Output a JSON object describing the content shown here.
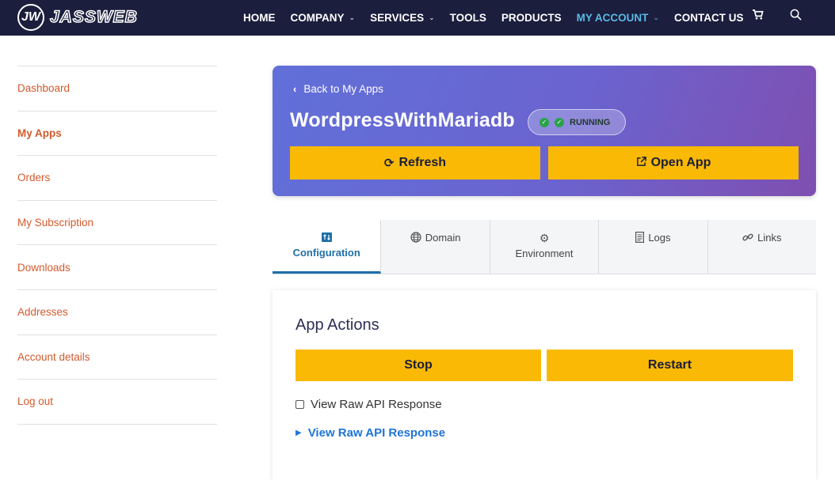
{
  "nav": {
    "brand": "JASSWEB",
    "brand_mark": "JW",
    "items": [
      {
        "label": "HOME",
        "caret": false,
        "active": false
      },
      {
        "label": "COMPANY",
        "caret": true,
        "active": false
      },
      {
        "label": "SERVICES",
        "caret": true,
        "active": false
      },
      {
        "label": "TOOLS",
        "caret": false,
        "active": false
      },
      {
        "label": "PRODUCTS",
        "caret": false,
        "active": false
      },
      {
        "label": "MY ACCOUNT",
        "caret": true,
        "active": true
      },
      {
        "label": "CONTACT US",
        "caret": false,
        "active": false
      }
    ],
    "cart_icon": "cart-icon",
    "search_icon": "search-icon",
    "active_color": "#5ab9e6"
  },
  "sidebar": {
    "items": [
      {
        "label": "Dashboard"
      },
      {
        "label": "My Apps",
        "current": true
      },
      {
        "label": "Orders"
      },
      {
        "label": "My Subscription"
      },
      {
        "label": "Downloads"
      },
      {
        "label": "Addresses"
      },
      {
        "label": "Account details"
      },
      {
        "label": "Log out"
      }
    ],
    "link_color": "#d35a2c"
  },
  "hero": {
    "back_label": "Back to My Apps",
    "app_name": "WordpressWithMariadb",
    "status": "RUNNING",
    "refresh_label": "Refresh",
    "open_label": "Open App",
    "button_color": "#f9b904"
  },
  "tabs": [
    {
      "label": "Configuration",
      "icon": "sliders-icon",
      "active": true
    },
    {
      "label": "Domain",
      "icon": "globe-icon",
      "active": false
    },
    {
      "label": "Environment",
      "icon": "gear-icon",
      "active": false
    },
    {
      "label": "Logs",
      "icon": "document-icon",
      "active": false
    },
    {
      "label": "Links",
      "icon": "link-icon",
      "active": false
    }
  ],
  "actions": {
    "title": "App Actions",
    "stop_label": "Stop",
    "restart_label": "Restart",
    "raw_checkbox_label": "View Raw API Response",
    "raw_details_label": "View Raw API Response"
  }
}
